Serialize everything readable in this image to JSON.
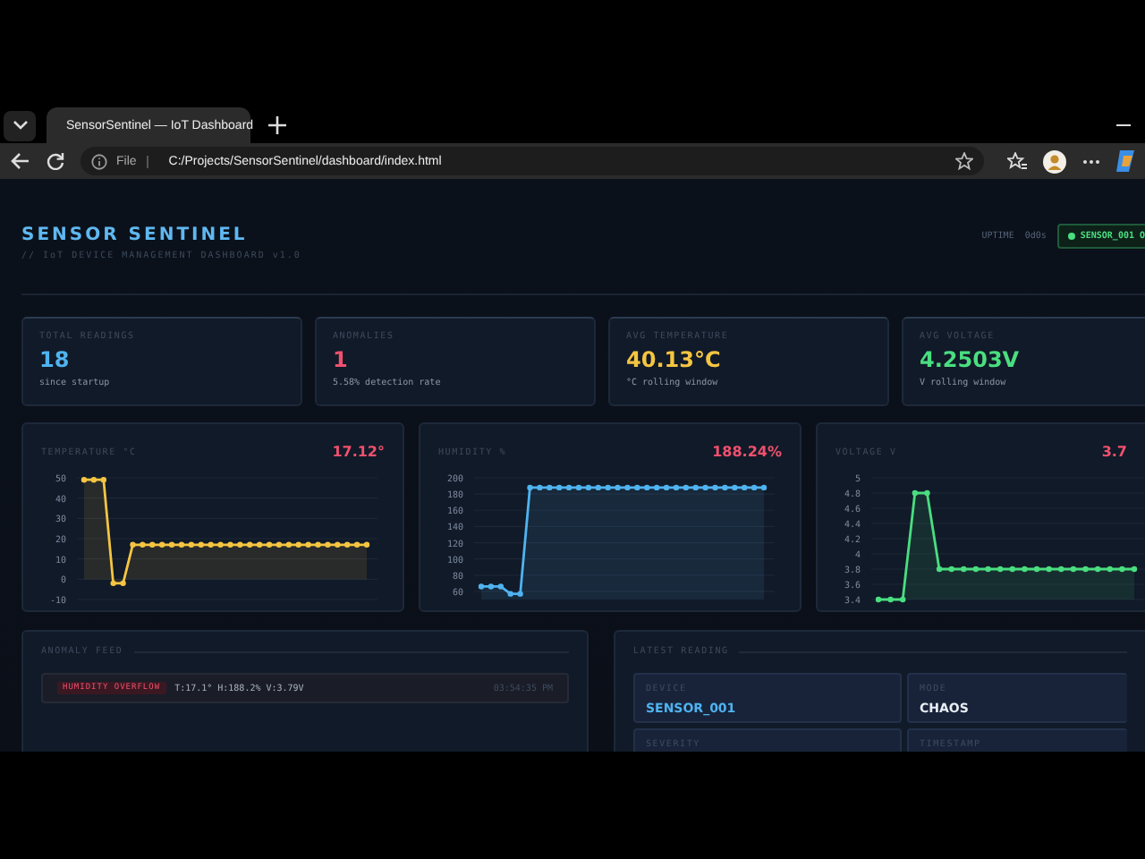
{
  "browser": {
    "tab": {
      "title": "SensorSentinel — IoT Dashboard"
    },
    "address": {
      "scheme": "File",
      "url": "C:/Projects/SensorSentinel/dashboard/index.html"
    }
  },
  "header": {
    "title": "SENSOR SENTINEL",
    "subtitle": "// IoT DEVICE MANAGEMENT DASHBOARD v1.0",
    "uptime_label": "UPTIME",
    "uptime": "0d0s",
    "status": "SENSOR_001 O"
  },
  "stats": [
    {
      "label": "TOTAL READINGS",
      "value": "18",
      "note": "since startup",
      "color": "#4fb3f0"
    },
    {
      "label": "ANOMALIES",
      "value": "1",
      "note": "5.58% detection rate",
      "color": "#f0506e"
    },
    {
      "label": "AVG TEMPERATURE",
      "value": "40.13°C",
      "note": "°C rolling window",
      "color": "#f5c542"
    },
    {
      "label": "AVG VOLTAGE",
      "value": "4.2503V",
      "note": "V rolling window",
      "color": "#4ade80"
    }
  ],
  "charts": [
    {
      "title": "TEMPERATURE °C",
      "reading": "17.12°",
      "chart_data": {
        "type": "area",
        "grid": true,
        "yticks": [
          50,
          40,
          30,
          20,
          10,
          0,
          -10
        ],
        "ylim": [
          -10,
          50
        ],
        "series": [
          {
            "color": "#f5c542",
            "marker": true,
            "values": [
              49,
              49,
              49,
              -2,
              -2,
              17,
              17,
              17,
              17,
              17,
              17,
              17,
              17,
              17,
              17,
              17,
              17,
              17,
              17,
              17,
              17,
              17,
              17,
              17,
              17,
              17,
              17,
              17,
              17,
              17
            ]
          }
        ]
      }
    },
    {
      "title": "HUMIDITY %",
      "reading": "188.24%",
      "chart_data": {
        "type": "area",
        "grid": true,
        "yticks": [
          200,
          180,
          160,
          140,
          120,
          100,
          80,
          60
        ],
        "ylim": [
          50,
          200
        ],
        "series": [
          {
            "color": "#4fb3f0",
            "marker": true,
            "values": [
              66,
              66,
              66,
              57,
              57,
              188,
              188,
              188,
              188,
              188,
              188,
              188,
              188,
              188,
              188,
              188,
              188,
              188,
              188,
              188,
              188,
              188,
              188,
              188,
              188,
              188,
              188,
              188,
              188,
              188
            ]
          }
        ]
      }
    },
    {
      "title": "VOLTAGE V",
      "reading": "3.7",
      "chart_data": {
        "type": "area",
        "grid": true,
        "yticks": [
          5.0,
          4.8,
          4.6,
          4.4,
          4.2,
          4.0,
          3.8,
          3.6,
          3.4
        ],
        "ylim": [
          3.4,
          5.0
        ],
        "series": [
          {
            "color": "#4ade80",
            "marker": true,
            "values": [
              3.4,
              3.4,
              3.4,
              4.8,
              4.8,
              3.8,
              3.8,
              3.8,
              3.8,
              3.8,
              3.8,
              3.8,
              3.8,
              3.8,
              3.8,
              3.8,
              3.8,
              3.8,
              3.8,
              3.8,
              3.8,
              3.8
            ]
          }
        ]
      }
    }
  ],
  "anomaly_feed": {
    "title": "ANOMALY FEED",
    "items": [
      {
        "tag": "HUMIDITY OVERFLOW",
        "detail": "T:17.1° H:188.2% V:3.79V",
        "time": "03:54:35 PM"
      }
    ]
  },
  "latest_reading": {
    "title": "LATEST READING",
    "fields": [
      {
        "label": "DEVICE",
        "value": "SENSOR_001",
        "color": "#4fb3f0"
      },
      {
        "label": "MODE",
        "value": "CHAOS",
        "color": "#e8edf3"
      },
      {
        "label": "SEVERITY"
      },
      {
        "label": "TIMESTAMP"
      }
    ]
  }
}
